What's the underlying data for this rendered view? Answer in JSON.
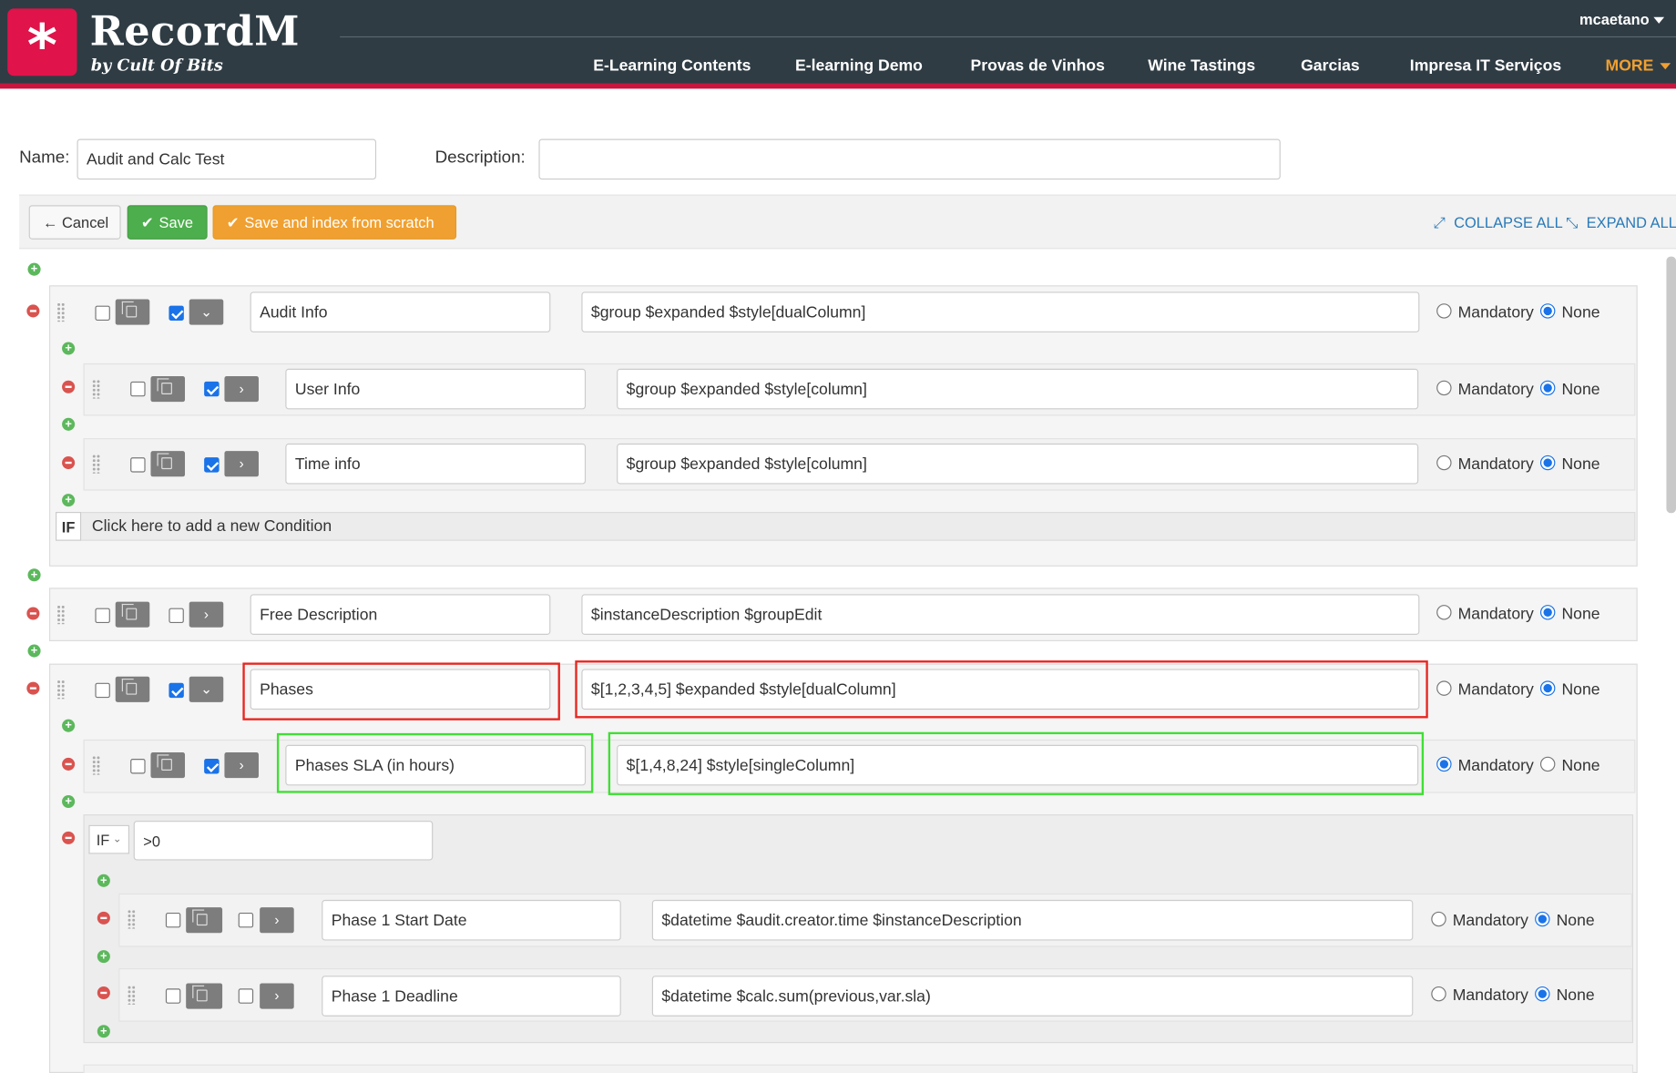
{
  "app": {
    "name": "RecordM",
    "tagline": "by Cult Of Bits",
    "logo_icon": "asterisk-icon",
    "brand_color": "#e0134b",
    "header_color": "#2f3c44"
  },
  "user": {
    "name": "mcaetano"
  },
  "nav": {
    "items": [
      "E-Learning Contents",
      "E-learning Demo",
      "Provas de Vinhos",
      "Wine Tastings",
      "Garcias",
      "Impresa IT Serviços"
    ],
    "more": "MORE"
  },
  "form": {
    "name_label": "Name:",
    "name_value": "Audit and Calc Test",
    "description_label": "Description:",
    "description_value": ""
  },
  "toolbar": {
    "cancel": "Cancel",
    "save": "Save",
    "save_index": "Save and index from scratch",
    "collapse_all": "COLLAPSE ALL",
    "expand_all": "EXPAND ALL"
  },
  "radio": {
    "mandatory": "Mandatory",
    "none": "None"
  },
  "fields": [
    {
      "name": "Audit Info",
      "description": "$group $expanded $style[dualColumn]",
      "checked": true,
      "expanded": true,
      "required": false
    },
    {
      "name": "User Info",
      "description": "$group $expanded $style[column]",
      "checked": true,
      "expanded": false,
      "required": false
    },
    {
      "name": "Time info",
      "description": "$group $expanded $style[column]",
      "checked": true,
      "expanded": false,
      "required": false
    },
    {
      "name": "Free Description",
      "description": "$instanceDescription $groupEdit",
      "checked": false,
      "expanded": false,
      "required": false
    },
    {
      "name": "Phases",
      "description": "$[1,2,3,4,5] $expanded $style[dualColumn]",
      "checked": true,
      "expanded": true,
      "required": false
    },
    {
      "name": "Phases SLA (in hours)",
      "description": "$[1,4,8,24] $style[singleColumn]",
      "checked": true,
      "expanded": false,
      "required": true
    },
    {
      "name": "Phase 1 Start Date",
      "description": "$datetime $audit.creator.time $instanceDescription",
      "checked": false,
      "expanded": false,
      "required": false
    },
    {
      "name": "Phase 1 Deadline",
      "description": "$datetime $calc.sum(previous,var.sla)",
      "checked": false,
      "expanded": false,
      "required": false
    }
  ],
  "conditions": {
    "if_label": "IF",
    "add_condition": "Click here to add a new Condition",
    "condition_value": ">0"
  }
}
